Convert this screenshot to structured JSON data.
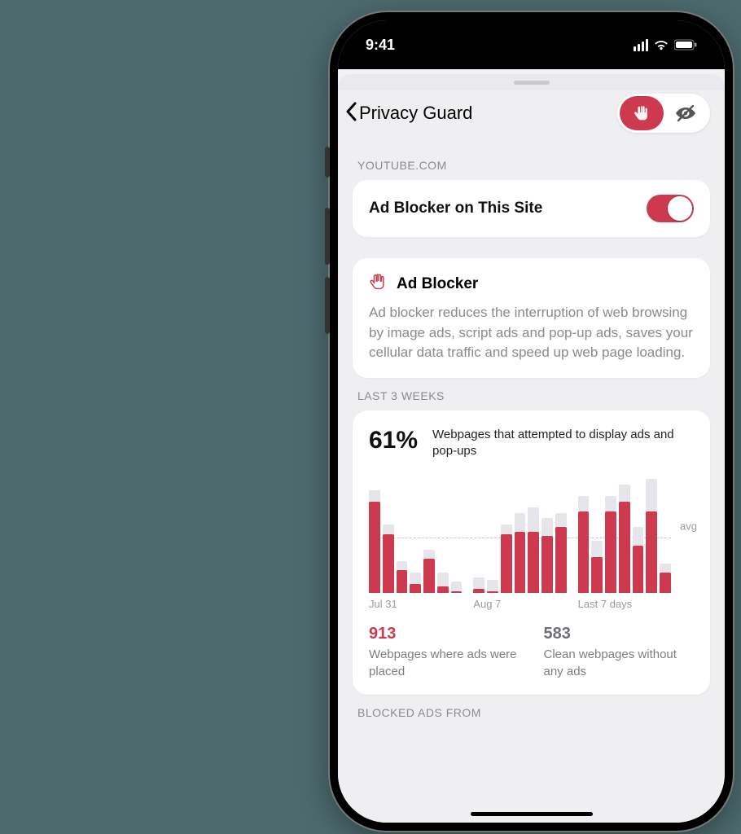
{
  "status": {
    "time": "9:41"
  },
  "nav": {
    "back_label": "Privacy Guard"
  },
  "site_section_header": "YOUTUBE.COM",
  "site_toggle": {
    "label": "Ad Blocker on This Site",
    "on": true
  },
  "info": {
    "title": "Ad Blocker",
    "description": "Ad blocker reduces the interruption of web browsing by image ads, script ads and pop-up ads, saves your cellular data traffic and speed up web page loading."
  },
  "period_header": "LAST 3 WEEKS",
  "stats": {
    "percent": "61%",
    "percent_caption": "Webpages that attempted to display ads and pop-ups",
    "avg_label": "avg",
    "summary": [
      {
        "value": "913",
        "caption": "Webpages where ads were placed",
        "color": "red"
      },
      {
        "value": "583",
        "caption": "Clean webpages without any ads",
        "color": "gray"
      }
    ]
  },
  "blocked_header": "BLOCKED ADS FROM",
  "chart_data": {
    "type": "bar",
    "title": "Webpages that attempted to display ads and pop-ups",
    "ylabel": "",
    "ylim": [
      0,
      100
    ],
    "avg": 48,
    "groups": [
      {
        "label": "Jul 31",
        "bars": [
          {
            "total": 90,
            "ads": 80
          },
          {
            "total": 60,
            "ads": 52
          },
          {
            "total": 28,
            "ads": 20
          },
          {
            "total": 18,
            "ads": 8
          },
          {
            "total": 38,
            "ads": 30
          },
          {
            "total": 18,
            "ads": 6
          },
          {
            "total": 10,
            "ads": 2
          }
        ]
      },
      {
        "label": "Aug 7",
        "bars": [
          {
            "total": 14,
            "ads": 4
          },
          {
            "total": 12,
            "ads": 2
          },
          {
            "total": 60,
            "ads": 52
          },
          {
            "total": 70,
            "ads": 54
          },
          {
            "total": 75,
            "ads": 54
          },
          {
            "total": 66,
            "ads": 50
          },
          {
            "total": 70,
            "ads": 58
          }
        ]
      },
      {
        "label": "Last 7 days",
        "bars": [
          {
            "total": 85,
            "ads": 72
          },
          {
            "total": 46,
            "ads": 32
          },
          {
            "total": 85,
            "ads": 72
          },
          {
            "total": 95,
            "ads": 80
          },
          {
            "total": 58,
            "ads": 42
          },
          {
            "total": 100,
            "ads": 72
          },
          {
            "total": 26,
            "ads": 18
          }
        ]
      }
    ]
  }
}
